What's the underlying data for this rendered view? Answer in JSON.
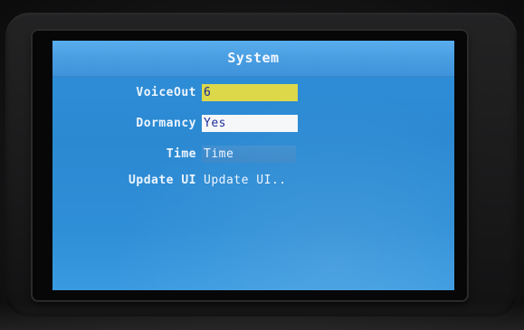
{
  "screen": {
    "title": "System",
    "rows": [
      {
        "label": "VoiceOut",
        "value": "6"
      },
      {
        "label": "Dormancy",
        "value": "Yes"
      },
      {
        "label": "Time",
        "value": "Time"
      },
      {
        "label": "Update UI",
        "value": "Update UI.."
      }
    ]
  },
  "colors": {
    "screen_bg": "#2e8ed6",
    "titlebar": "#4a9fe3",
    "selected_field": "#dcd84a",
    "edit_field": "#f6f7f8",
    "value_text": "#1e2f9f",
    "label_text": "#eef5ff"
  }
}
